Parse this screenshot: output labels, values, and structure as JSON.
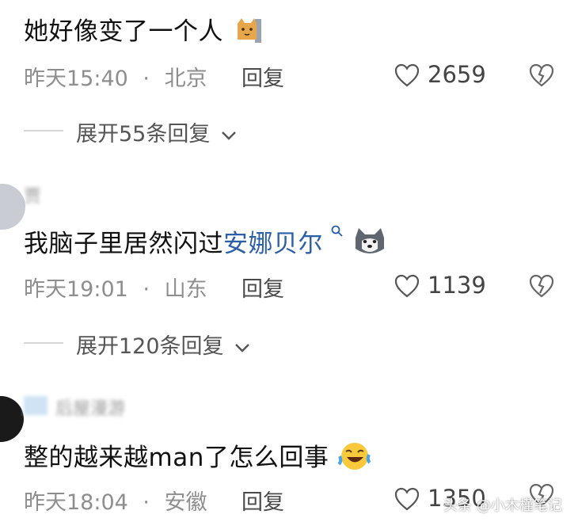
{
  "comments": [
    {
      "text": "她好像变了一个人",
      "time": "昨天15:40",
      "location": "北京",
      "reply_label": "回复",
      "likes": "2659",
      "expand_label": "展开55条回复"
    },
    {
      "username": "贾",
      "text_prefix": "我脑子里居然闪过",
      "link_text": "安娜贝尔",
      "time": "昨天19:01",
      "location": "山东",
      "reply_label": "回复",
      "likes": "1139",
      "expand_label": "展开120条回复"
    },
    {
      "username": "后屋漫游",
      "text": "整的越来越man了怎么回事",
      "time": "昨天18:04",
      "location": "安徽",
      "reply_label": "回复",
      "likes": "1350"
    }
  ],
  "separator": "·",
  "watermark": "头条 @小木槿笔记",
  "icons": {
    "like": "heart-outline-icon",
    "dislike": "broken-heart-icon",
    "expand": "chevron-down-icon",
    "search": "search-icon"
  },
  "colors": {
    "link": "#2b5fa8",
    "meta": "#8e8e8e"
  }
}
